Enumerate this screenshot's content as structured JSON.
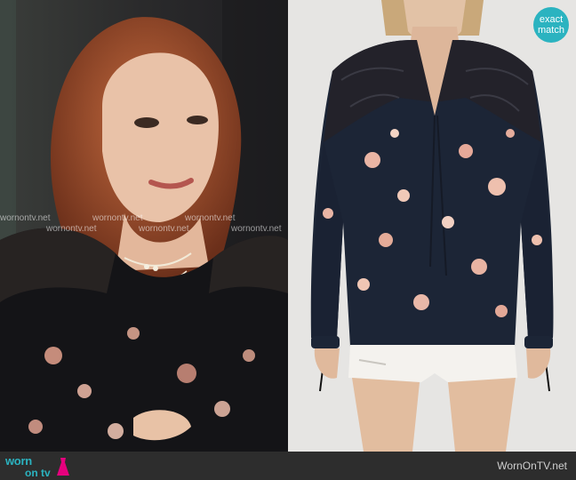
{
  "badge": {
    "text_line1": "exact",
    "text_line2": "match"
  },
  "watermark": "wornontv.net",
  "footer": {
    "site": "WornOnTV.net",
    "logo_top": "worn",
    "logo_bottom": "on tv"
  },
  "colors": {
    "accent": "#2bb3c0",
    "footer_bg": "#2d2d2d",
    "product_bg": "#e6e5e3",
    "blouse": "#1c2536"
  }
}
